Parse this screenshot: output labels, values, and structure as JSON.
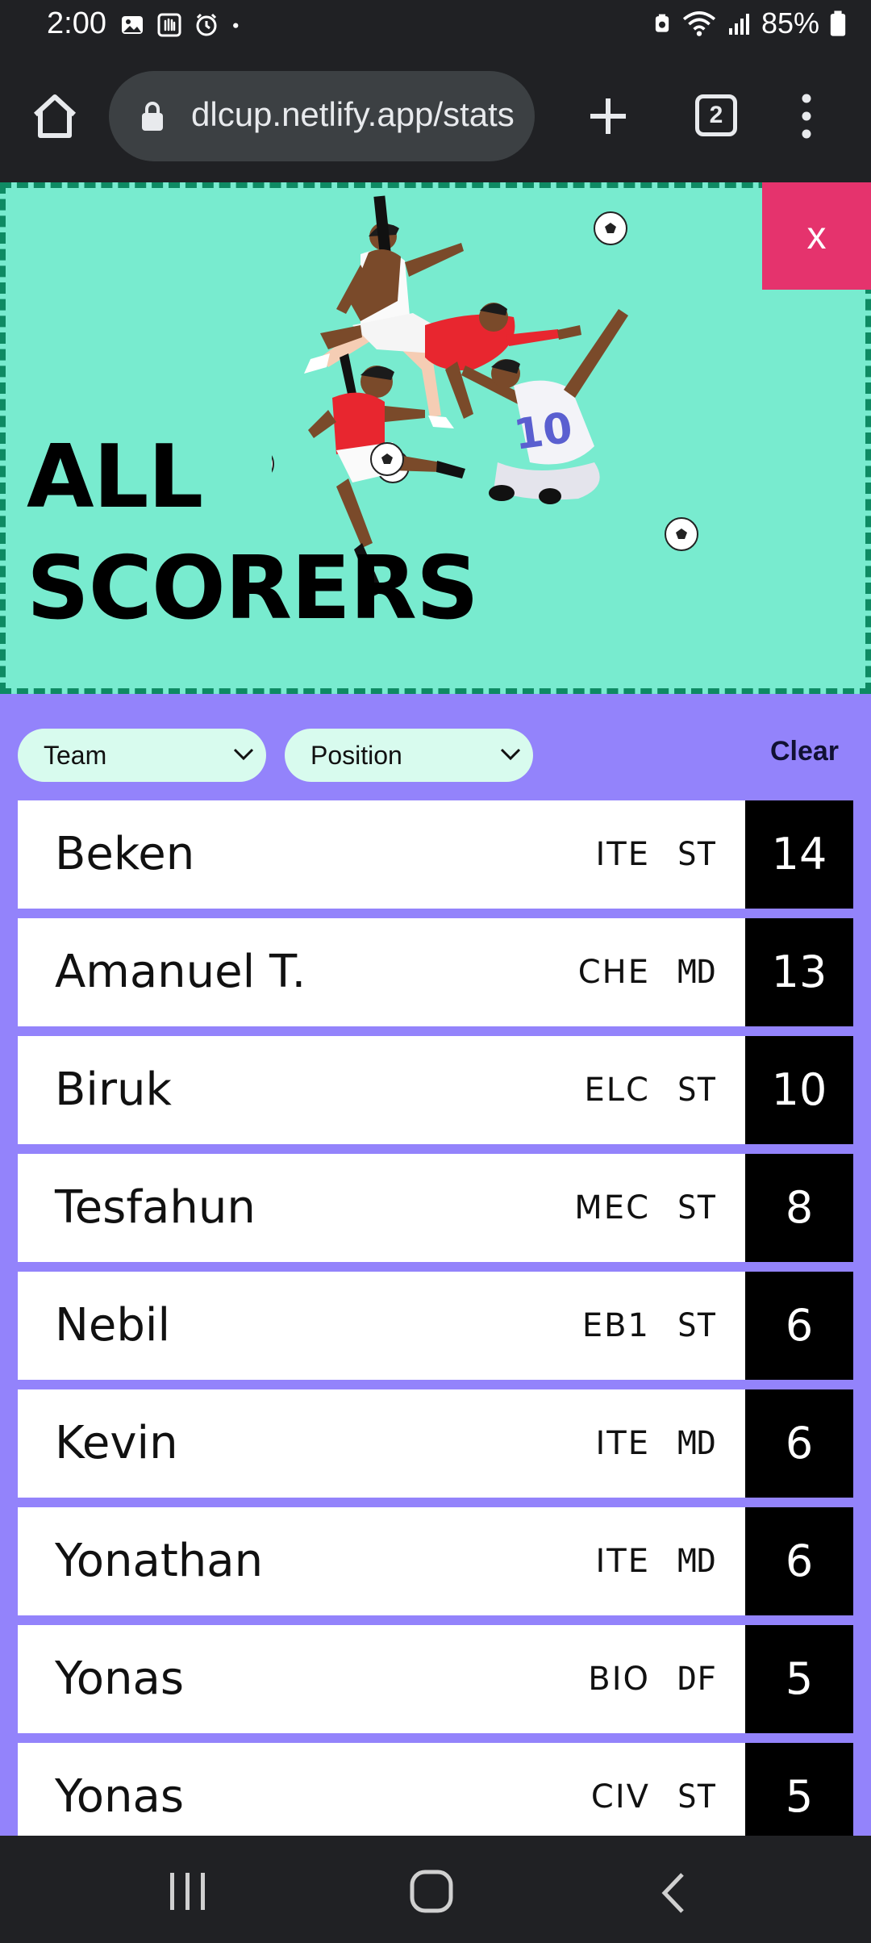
{
  "status_bar": {
    "time": "2:00",
    "battery": "85%",
    "left_icons": [
      "image-icon",
      "hand-icon",
      "alarm-icon",
      "dot-icon"
    ],
    "right_icons": [
      "battery-saver-icon",
      "wifi-icon",
      "signal-icon",
      "battery-icon"
    ]
  },
  "browser": {
    "url": "dlcup.netlify.app/stats",
    "tab_count": "2"
  },
  "banner": {
    "title_line1": "ALL",
    "title_line2": "SCORERS",
    "close_label": "x"
  },
  "filters": {
    "team_label": "Team",
    "position_label": "Position",
    "clear_label": "Clear"
  },
  "scorers": [
    {
      "name": "Beken",
      "team": "ITE",
      "position": "ST",
      "goals": "14"
    },
    {
      "name": "Amanuel T.",
      "team": "CHE",
      "position": "MD",
      "goals": "13"
    },
    {
      "name": "Biruk",
      "team": "ELC",
      "position": "ST",
      "goals": "10"
    },
    {
      "name": "Tesfahun",
      "team": "MEC",
      "position": "ST",
      "goals": "8"
    },
    {
      "name": "Nebil",
      "team": "EB1",
      "position": "ST",
      "goals": "6"
    },
    {
      "name": "Kevin",
      "team": "ITE",
      "position": "MD",
      "goals": "6"
    },
    {
      "name": "Yonathan",
      "team": "ITE",
      "position": "MD",
      "goals": "6"
    },
    {
      "name": "Yonas",
      "team": "BIO",
      "position": "DF",
      "goals": "5"
    },
    {
      "name": "Yonas",
      "team": "CIV",
      "position": "ST",
      "goals": "5"
    }
  ],
  "colors": {
    "banner_bg": "#78ebcf",
    "banner_border": "#0e8a63",
    "close_bg": "#e5336d",
    "list_bg": "#9383fb",
    "filter_bg": "#d8fbee",
    "goals_bg": "#000000"
  }
}
